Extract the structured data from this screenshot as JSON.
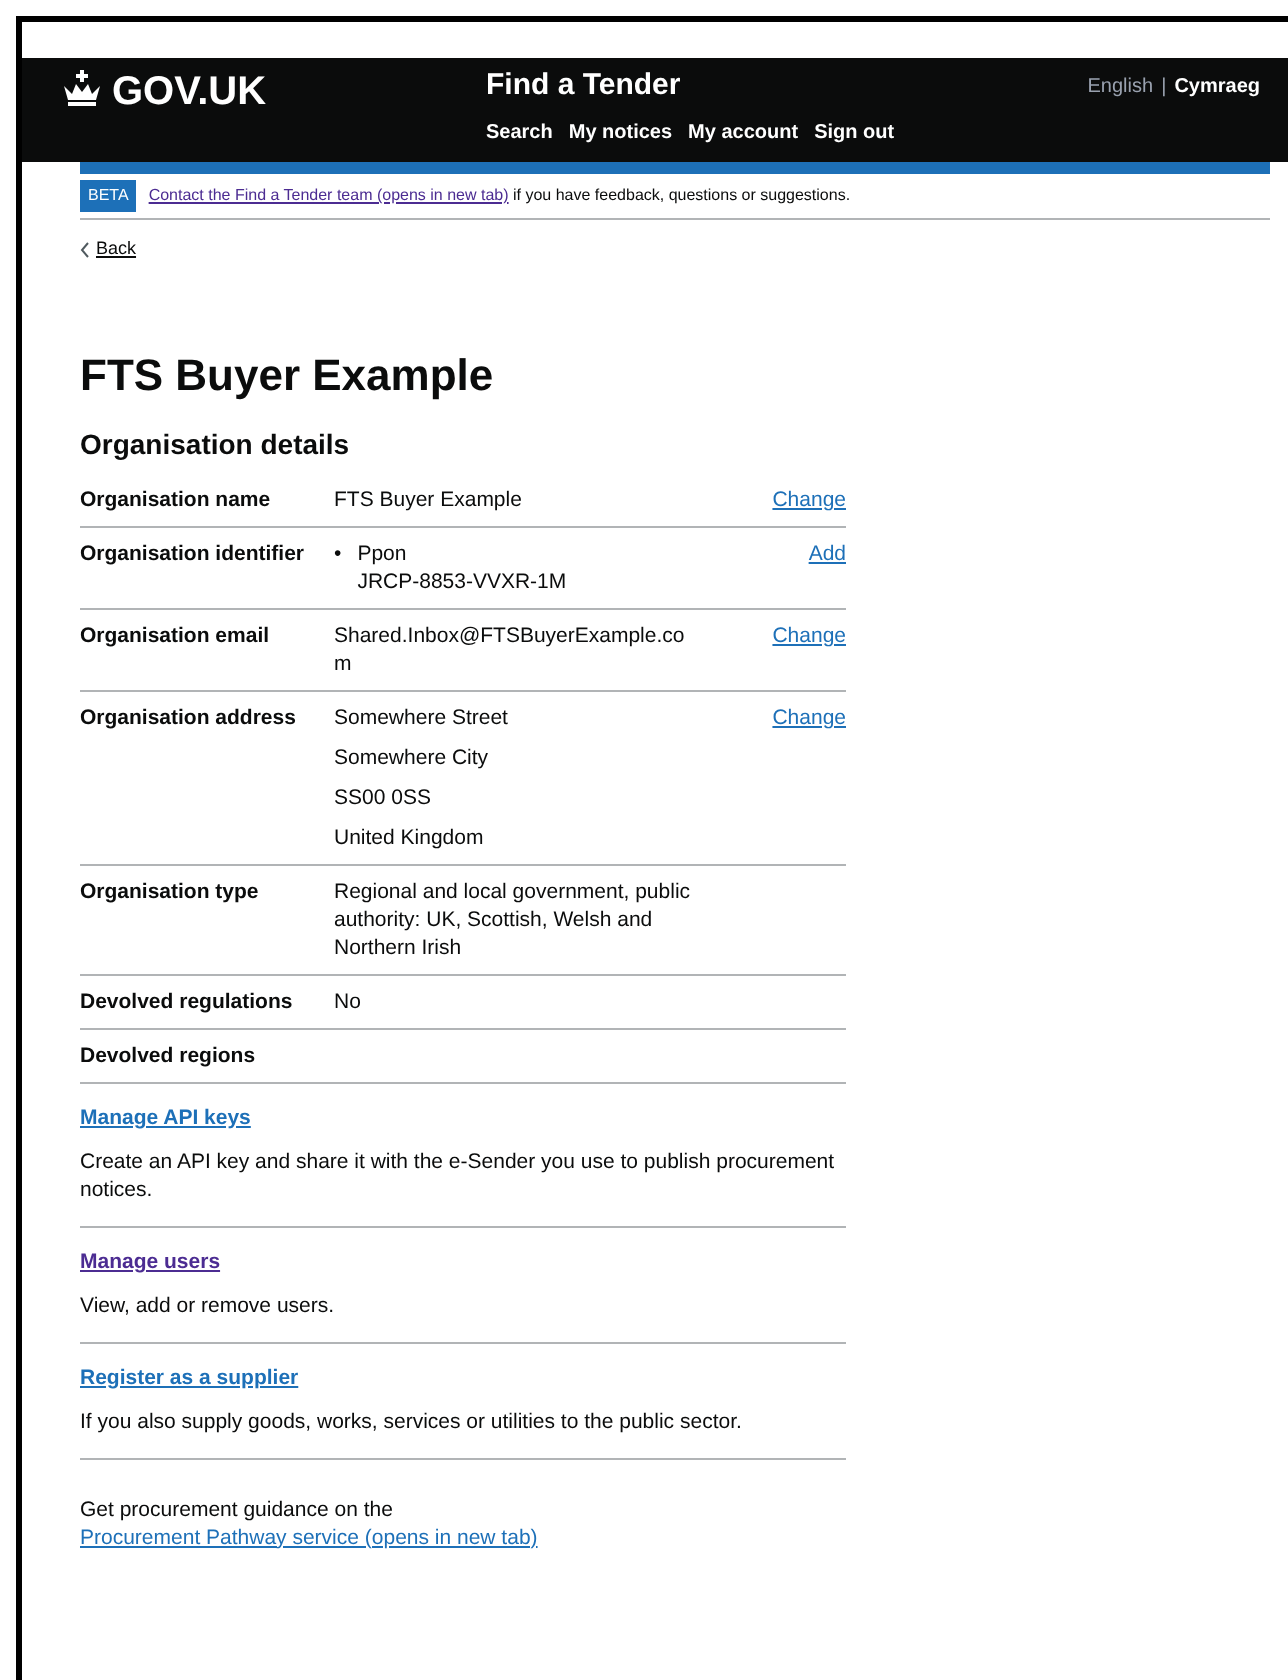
{
  "header": {
    "logo": "GOV.UK",
    "service": "Find a Tender",
    "languages": [
      {
        "label": "English",
        "selected": false
      },
      {
        "label": "Cymraeg",
        "selected": true
      }
    ],
    "language_separator": "|",
    "nav": [
      "Search",
      "My notices",
      "My account",
      "Sign out"
    ]
  },
  "phase_banner": {
    "tag": "BETA",
    "link": "Contact the Find a Tender team (opens in new tab)",
    "text": " if you have feedback, questions or suggestions."
  },
  "back_link": "Back",
  "title": "FTS Buyer Example",
  "section_title": "Organisation details",
  "summary": [
    {
      "key": "Organisation name",
      "values": [
        "FTS Buyer Example"
      ],
      "action": "Change",
      "kind": "plain"
    },
    {
      "key": "Organisation identifier",
      "bullet": "•",
      "values": [
        "Ppon",
        "JRCP-8853-VVXR-1M"
      ],
      "action": "Add",
      "kind": "bullet"
    },
    {
      "key": "Organisation email",
      "values": [
        "Shared.Inbox@FTSBuyerExample.com"
      ],
      "action": "Change",
      "kind": "plain"
    },
    {
      "key": "Organisation address",
      "values": [
        "Somewhere Street",
        "Somewhere City",
        "SS00 0SS",
        "United Kingdom"
      ],
      "action": "Change",
      "kind": "lines"
    },
    {
      "key": "Organisation type",
      "values": [
        "Regional and local government, public authority: UK, Scottish, Welsh and Northern Irish"
      ],
      "kind": "plain"
    },
    {
      "key": "Devolved regulations",
      "values": [
        "No"
      ],
      "kind": "plain"
    },
    {
      "key": "Devolved regions",
      "kind": "plain"
    }
  ],
  "actions": [
    {
      "link": "Manage API keys",
      "visited": false,
      "description": "Create an API key and share it with the e-Sender you use to publish procurement notices."
    },
    {
      "link": "Manage users",
      "visited": true,
      "description": "View, add or remove users."
    },
    {
      "link": "Register as a supplier",
      "visited": false,
      "description": "If you also supply goods, works, services or utilities to the public sector."
    }
  ],
  "guidance": {
    "text": "Get procurement guidance on the ",
    "link": "Procurement Pathway service (opens in new tab)"
  }
}
